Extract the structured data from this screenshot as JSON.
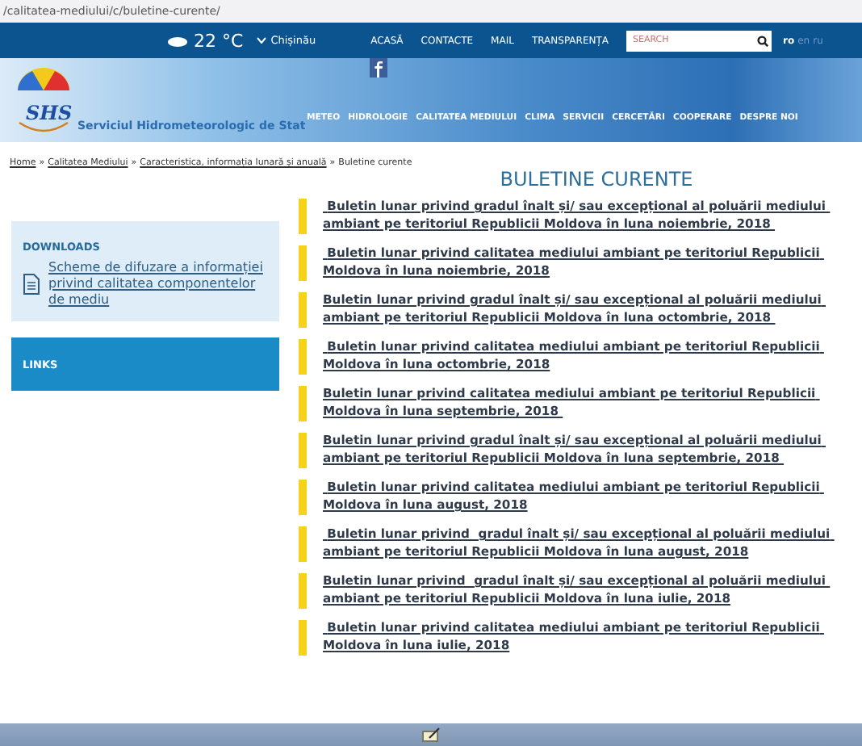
{
  "address_bar": {
    "url": "/calitatea-mediului/c/buletine-curente/"
  },
  "top_bar": {
    "weather": {
      "temperature": "22 °C",
      "city": "Chișinău"
    },
    "links": [
      "ACASĂ",
      "CONTACTE",
      "MAIL",
      "TRANSPARENȚA"
    ],
    "search": {
      "placeholder": "SEARCH"
    },
    "languages": [
      {
        "label": "ro",
        "selected": true
      },
      {
        "label": "en",
        "selected": false
      },
      {
        "label": "ru",
        "selected": false
      }
    ]
  },
  "header": {
    "logo_text": "SHS",
    "site_name": "Serviciul Hidrometeorologic de Stat",
    "nav": [
      "METEO",
      "HIDROLOGIE",
      "CALITATEA MEDIULUI",
      "CLIMA",
      "SERVICII",
      "CERCETĂRI",
      "COOPERARE",
      "DESPRE NOI"
    ]
  },
  "breadcrumb": {
    "separator": "»",
    "items": [
      "Home",
      "Calitatea Mediului",
      "Caracteristica, informația lunară și anuală",
      "Buletine curente"
    ]
  },
  "sidebar": {
    "downloads": {
      "title": "DOWNLOADS",
      "items": [
        "Scheme de difuzare a informației privind calitatea componentelor de mediu"
      ]
    },
    "links": {
      "title": "LINKS"
    }
  },
  "page_title": "BULETINE CURENTE",
  "bulletins": [
    " Buletin lunar privind gradul înalt și/ sau excepțional al poluării mediului ambiant pe teritoriul Republicii Moldova în luna noiembrie, 2018 ",
    " Buletin lunar privind calitatea mediului ambiant pe teritoriul Republicii Moldova în luna noiembrie, 2018",
    "Buletin lunar privind gradul înalt și/ sau excepțional al poluării mediului ambiant pe teritoriul Republicii Moldova în luna octombrie, 2018 ",
    " Buletin lunar privind calitatea mediului ambiant pe teritoriul Republicii Moldova în luna octombrie, 2018",
    "Buletin lunar privind calitatea mediului ambiant pe teritoriul Republicii Moldova în luna septembrie, 2018 ",
    "Buletin lunar privind gradul înalt și/ sau excepțional al poluării mediului ambiant pe teritoriul Republicii Moldova în luna septembrie, 2018 ",
    " Buletin lunar privind calitatea mediului ambiant pe teritoriul Republicii Moldova în luna august, 2018",
    " Buletin lunar privind  gradul înalt și/ sau excepțional al poluării mediului ambiant pe teritoriul Republicii Moldova în luna august, 2018",
    "Buletin lunar privind  gradul înalt și/ sau excepțional al poluării mediului ambiant pe teritoriul Republicii Moldova în luna iulie, 2018",
    " Buletin lunar privind calitatea mediului ambiant pe teritoriul Republicii Moldova în luna iulie, 2018"
  ]
}
